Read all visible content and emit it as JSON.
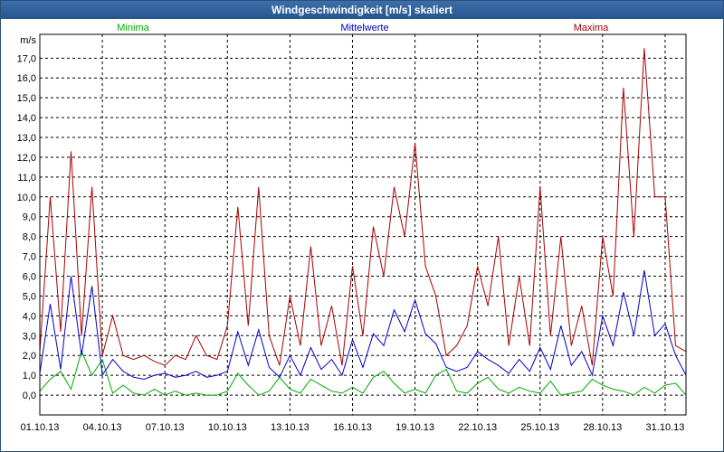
{
  "window": {
    "title": "Windgeschwindigkeit [m/s] skaliert"
  },
  "colors": {
    "minima": "#00aa00",
    "mittelwerte": "#0000cc",
    "maxima": "#aa0000",
    "titlebar": "#2f5f98",
    "grid": "#000000"
  },
  "chart_data": {
    "type": "line",
    "title": "Windgeschwindigkeit [m/s] skaliert",
    "ylabel": "m/s",
    "xlabel": "",
    "ylim": [
      -1.0,
      18.2
    ],
    "grid": true,
    "legend_placement": "top",
    "x_ticks": [
      "01.10.13",
      "04.10.13",
      "07.10.13",
      "10.10.13",
      "13.10.13",
      "16.10.13",
      "19.10.13",
      "22.10.13",
      "25.10.13",
      "28.10.13",
      "31.10.13"
    ],
    "y_ticks": [
      "0,0",
      "1,0",
      "2,0",
      "3,0",
      "4,0",
      "5,0",
      "6,0",
      "7,0",
      "8,0",
      "9,0",
      "10,0",
      "11,0",
      "12,0",
      "13,0",
      "14,0",
      "15,0",
      "16,0",
      "17,0"
    ],
    "x_unit": "day since 01.10.13 (x=0 is 01.10.13, x=30 is 31.10.13)",
    "series": [
      {
        "name": "Minima",
        "color": "#00aa00",
        "x": [
          0,
          0.5,
          1,
          1.5,
          2,
          2.5,
          3,
          3.5,
          4,
          4.5,
          5,
          5.5,
          6,
          6.5,
          7,
          7.5,
          8,
          8.5,
          9,
          9.5,
          10,
          10.5,
          11,
          11.5,
          12,
          12.5,
          13,
          13.5,
          14,
          14.5,
          15,
          15.5,
          16,
          16.5,
          17,
          17.5,
          18,
          18.5,
          19,
          19.5,
          20,
          20.5,
          21,
          21.5,
          22,
          22.5,
          23,
          23.5,
          24,
          24.5,
          25,
          25.5,
          26,
          26.5,
          27,
          27.5,
          28,
          28.5,
          29,
          29.5,
          30,
          30.5,
          31
        ],
        "values": [
          0.2,
          0.8,
          1.2,
          0.3,
          2.2,
          1.0,
          1.8,
          0.1,
          0.5,
          0.1,
          0.0,
          0.3,
          0.0,
          0.2,
          0.0,
          0.1,
          0.0,
          0.0,
          0.2,
          1.1,
          0.5,
          0.0,
          0.2,
          0.9,
          0.3,
          0.1,
          0.8,
          0.5,
          0.2,
          0.1,
          0.4,
          0.1,
          0.9,
          1.2,
          0.6,
          0.1,
          0.3,
          0.1,
          1.0,
          1.3,
          0.2,
          0.1,
          0.6,
          0.9,
          0.3,
          0.1,
          0.4,
          0.2,
          0.1,
          0.7,
          0.0,
          0.1,
          0.2,
          0.8,
          0.5,
          0.3,
          0.2,
          0.0,
          0.4,
          0.1,
          0.5,
          0.6,
          0.0
        ]
      },
      {
        "name": "Mittelwerte",
        "color": "#0000cc",
        "x": [
          0,
          0.5,
          1,
          1.5,
          2,
          2.5,
          3,
          3.5,
          4,
          4.5,
          5,
          5.5,
          6,
          6.5,
          7,
          7.5,
          8,
          8.5,
          9,
          9.5,
          10,
          10.5,
          11,
          11.5,
          12,
          12.5,
          13,
          13.5,
          14,
          14.5,
          15,
          15.5,
          16,
          16.5,
          17,
          17.5,
          18,
          18.5,
          19,
          19.5,
          20,
          20.5,
          21,
          21.5,
          22,
          22.5,
          23,
          23.5,
          24,
          24.5,
          25,
          25.5,
          26,
          26.5,
          27,
          27.5,
          28,
          28.5,
          29,
          29.5,
          30,
          30.5,
          31
        ],
        "values": [
          1.1,
          4.6,
          1.3,
          6.0,
          2.0,
          5.5,
          1.0,
          1.8,
          1.2,
          0.9,
          0.8,
          1.0,
          1.1,
          0.9,
          1.0,
          1.2,
          0.9,
          1.0,
          1.2,
          3.2,
          1.5,
          3.3,
          1.4,
          0.9,
          2.0,
          1.0,
          2.4,
          1.3,
          1.8,
          1.0,
          2.8,
          1.4,
          3.1,
          2.5,
          4.3,
          3.2,
          4.8,
          3.1,
          2.6,
          1.4,
          1.2,
          1.4,
          2.2,
          1.8,
          1.5,
          1.1,
          1.8,
          1.2,
          2.4,
          1.3,
          3.5,
          1.5,
          2.2,
          1.0,
          4.0,
          2.5,
          5.2,
          3.0,
          6.3,
          3.0,
          3.6,
          2.0,
          1.0
        ]
      },
      {
        "name": "Maxima",
        "color": "#aa0000",
        "x": [
          0,
          0.5,
          1,
          1.5,
          2,
          2.5,
          3,
          3.5,
          4,
          4.5,
          5,
          5.5,
          6,
          6.5,
          7,
          7.5,
          8,
          8.5,
          9,
          9.5,
          10,
          10.5,
          11,
          11.5,
          12,
          12.5,
          13,
          13.5,
          14,
          14.5,
          15,
          15.5,
          16,
          16.5,
          17,
          17.5,
          18,
          18.5,
          19,
          19.5,
          20,
          20.5,
          21,
          21.5,
          22,
          22.5,
          23,
          23.5,
          24,
          24.5,
          25,
          25.5,
          26,
          26.5,
          27,
          27.5,
          28,
          28.5,
          29,
          29.5,
          30,
          30.5,
          31
        ],
        "values": [
          2.2,
          10.0,
          3.2,
          12.3,
          3.0,
          10.5,
          2.0,
          4.0,
          2.0,
          1.8,
          2.0,
          1.7,
          1.5,
          2.0,
          1.8,
          3.0,
          2.0,
          1.8,
          3.5,
          9.5,
          3.5,
          10.5,
          3.0,
          1.5,
          5.0,
          2.5,
          7.5,
          2.5,
          4.5,
          1.5,
          6.5,
          3.0,
          8.5,
          6.0,
          10.5,
          8.0,
          12.7,
          6.5,
          5.0,
          2.0,
          2.5,
          3.5,
          6.5,
          4.5,
          8.0,
          2.5,
          6.0,
          2.5,
          10.5,
          3.0,
          8.0,
          2.5,
          4.5,
          1.5,
          8.0,
          5.0,
          15.5,
          8.0,
          17.5,
          10.0,
          10.0,
          2.5,
          2.2
        ]
      }
    ]
  }
}
